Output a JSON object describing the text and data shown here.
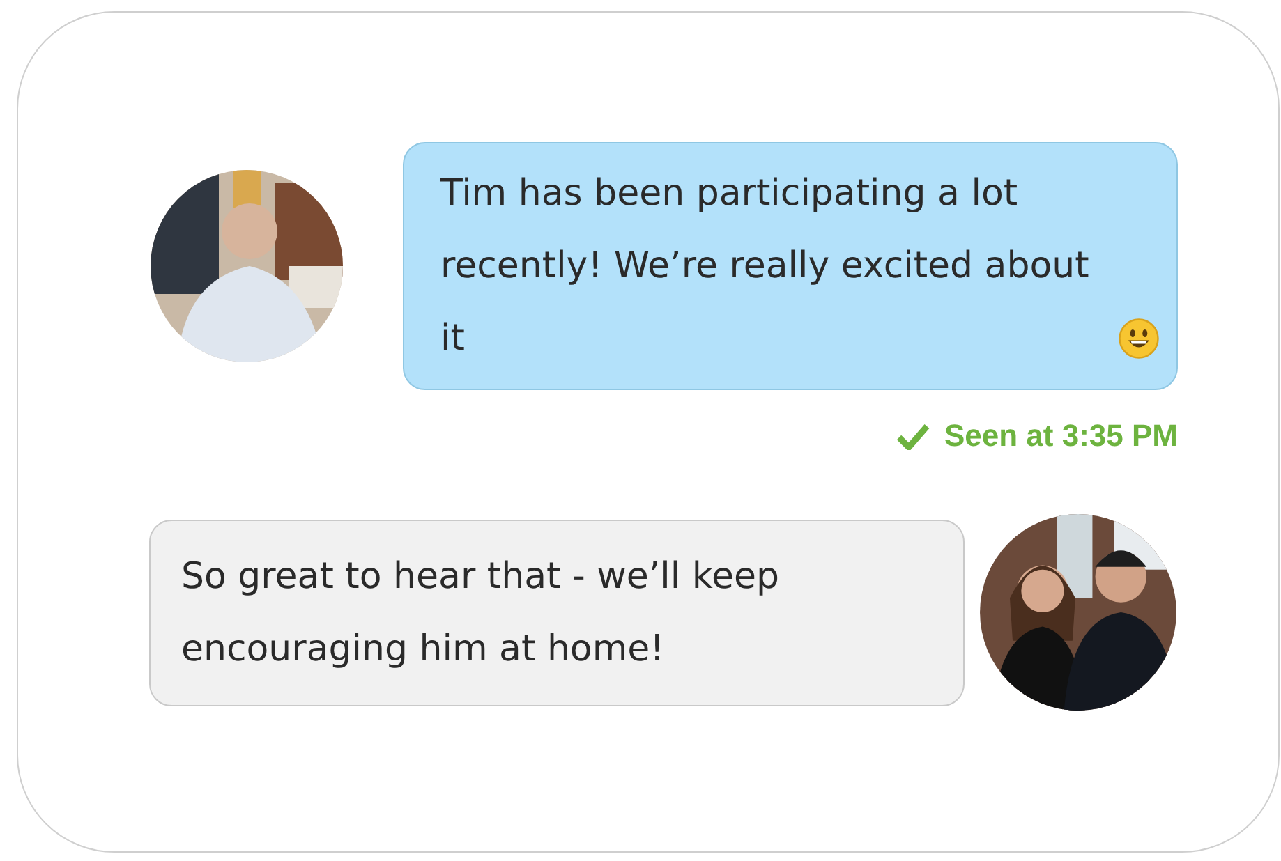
{
  "messages": [
    {
      "kind": "sent",
      "text": "Tim has been participating a lot recently! We’re really excited about it",
      "emoji": true,
      "status": {
        "text": "Seen at 3:35 PM",
        "checked": true
      }
    },
    {
      "kind": "received",
      "text": "So great to hear that - we’ll keep encouraging him at home!",
      "emoji": false
    }
  ]
}
